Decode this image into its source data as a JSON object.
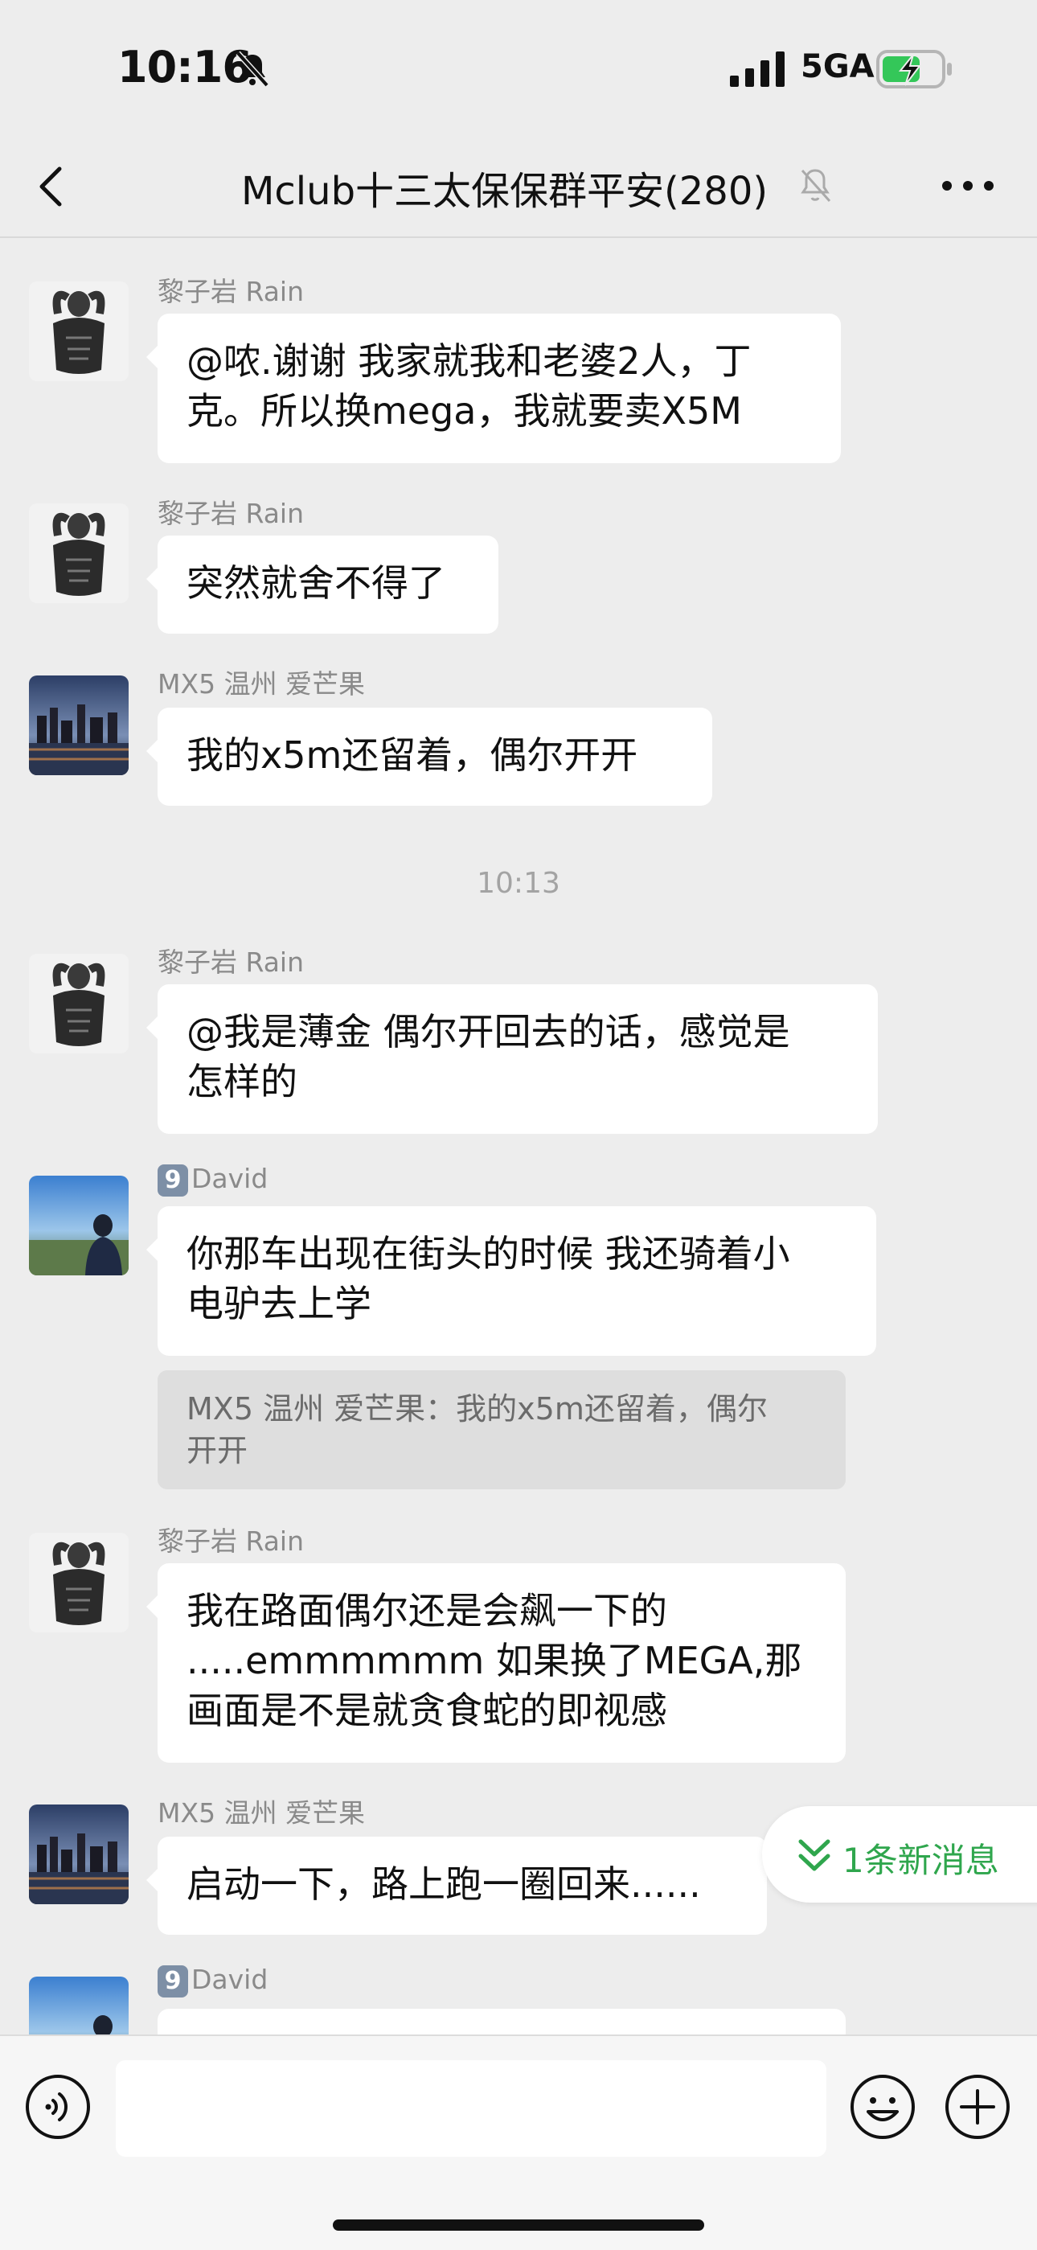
{
  "status": {
    "time": "10:16",
    "network": "5GA"
  },
  "nav": {
    "title": "Mclub十三太保保群平安(280)"
  },
  "messages": [
    {
      "sender": "黎子岩 Rain",
      "text": "@哝.谢谢 我家就我和老婆2人，丁\n克。所以换mega，我就要卖X5M"
    },
    {
      "sender": "黎子岩 Rain",
      "text": "突然就舍不得了"
    },
    {
      "sender": "MX5 温州 爱芒果",
      "text": "我的x5m还留着，偶尔开开"
    },
    {
      "sender": "黎子岩 Rain",
      "text": "@我是薄金 偶尔开回去的话，感觉是\n怎样的"
    },
    {
      "sender_badge": "9",
      "sender": "David",
      "text": "你那车出现在街头的时候 我还骑着小\n电驴去上学",
      "quote": "MX5 温州 爱芒果：我的x5m还留着，偶尔\n开开"
    },
    {
      "sender": "黎子岩 Rain",
      "text": "我在路面偶尔还是会飙一下的\n.....emmmmmm 如果换了MEGA,那\n画面是不是就贪食蛇的即视感"
    },
    {
      "sender": "MX5 温州 爱芒果",
      "text": "启动一下，路上跑一圈回来......"
    },
    {
      "sender_badge": "9",
      "sender": "David"
    }
  ],
  "time_separator": "10:13",
  "new_messages": {
    "label": "1条新消息"
  },
  "icons": {
    "status_bell": "bell-off-icon",
    "back": "chevron-left-icon",
    "mute": "bell-mute-icon",
    "more": "more-dots-icon",
    "voice": "voice-icon",
    "emoji": "emoji-icon",
    "plus": "plus-icon",
    "new_msg": "double-chevron-down-icon"
  },
  "colors": {
    "background": "#ededed",
    "bubble": "#ffffff",
    "accent_green": "#2fa64d",
    "sender_gray": "#8a8a8a"
  }
}
